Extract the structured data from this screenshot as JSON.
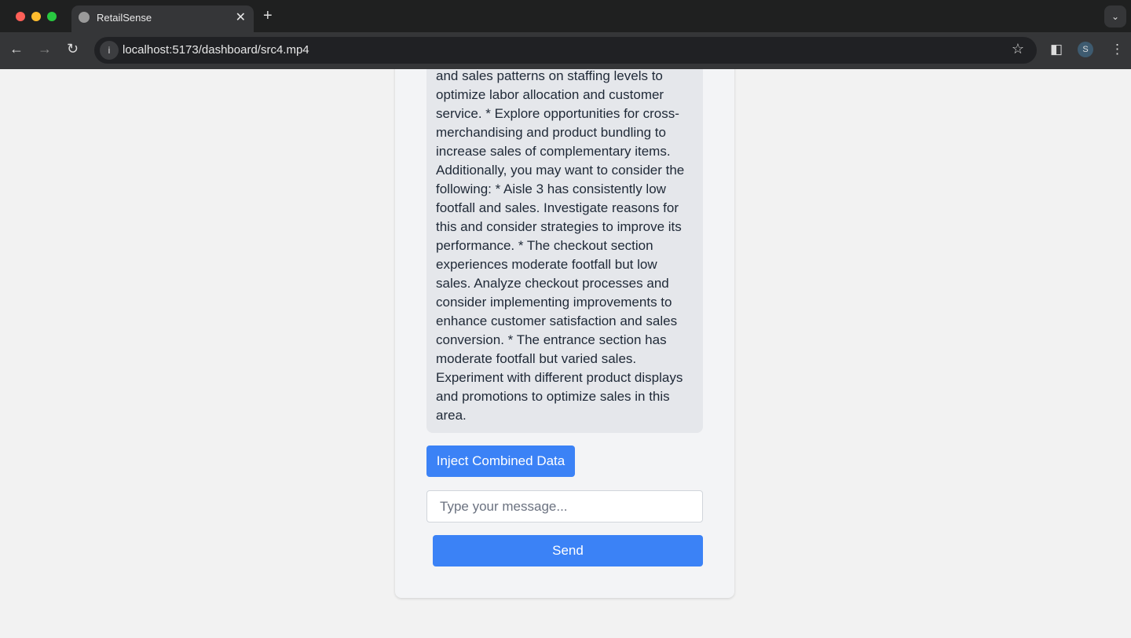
{
  "browser": {
    "tab_title": "RetailSense",
    "url": "localhost:5173/dashboard/src4.mp4",
    "profile_initial": "S"
  },
  "chat": {
    "message": "satisfaction. * Evaluate the impact of footfall and sales patterns on staffing levels to optimize labor allocation and customer service. * Explore opportunities for cross-merchandising and product bundling to increase sales of complementary items. Additionally, you may want to consider the following: * Aisle 3 has consistently low footfall and sales. Investigate reasons for this and consider strategies to improve its performance. * The checkout section experiences moderate footfall but low sales. Analyze checkout processes and consider implementing improvements to enhance customer satisfaction and sales conversion. * The entrance section has moderate footfall but varied sales. Experiment with different product displays and promotions to optimize sales in this area.",
    "inject_label": "Inject Combined Data",
    "input_placeholder": "Type your message...",
    "input_value": "",
    "send_label": "Send"
  },
  "colors": {
    "accent": "#3b82f6",
    "bubble": "#e5e7eb"
  }
}
